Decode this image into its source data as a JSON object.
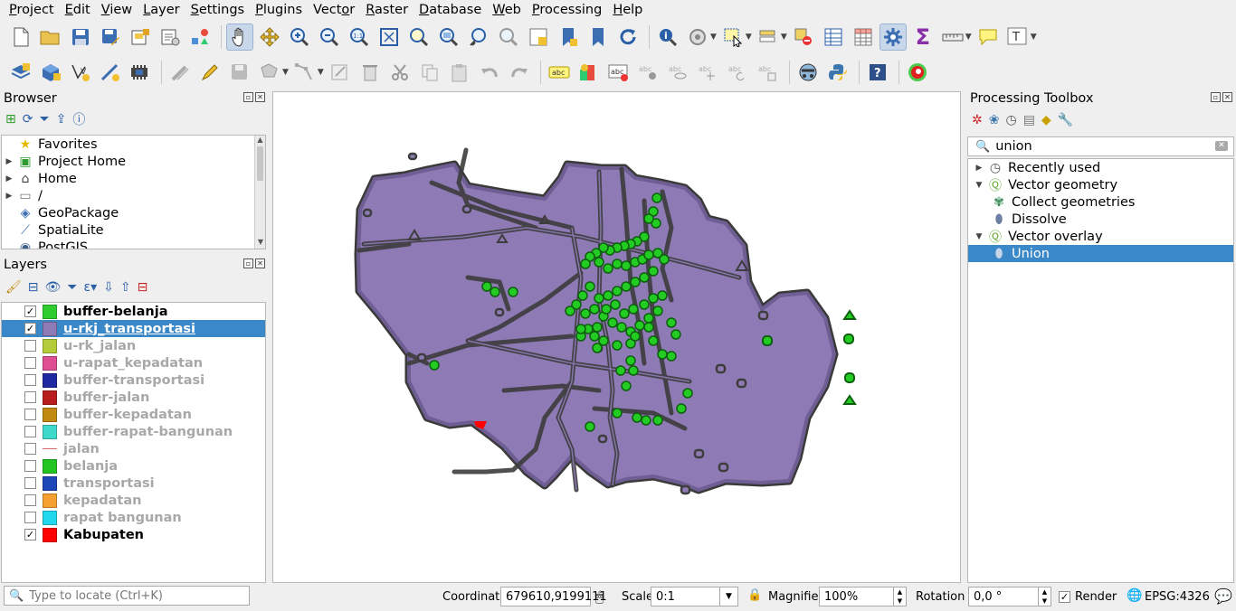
{
  "menu": [
    "Project",
    "Edit",
    "View",
    "Layer",
    "Settings",
    "Plugins",
    "Vector",
    "Raster",
    "Database",
    "Web",
    "Processing",
    "Help"
  ],
  "menu_underline": [
    "P",
    "E",
    "V",
    "L",
    "S",
    "P",
    "o",
    "R",
    "D",
    "W",
    "P",
    "H"
  ],
  "browser": {
    "title": "Browser",
    "items": [
      {
        "label": "Favorites",
        "icon": "star-icon",
        "expandable": false
      },
      {
        "label": "Project Home",
        "icon": "project-home-icon",
        "expandable": true
      },
      {
        "label": "Home",
        "icon": "home-icon",
        "expandable": true
      },
      {
        "label": "/",
        "icon": "folder-icon",
        "expandable": true
      },
      {
        "label": "GeoPackage",
        "icon": "geopackage-icon",
        "expandable": false
      },
      {
        "label": "SpatiaLite",
        "icon": "spatialite-icon",
        "expandable": false
      },
      {
        "label": "PostGIS",
        "icon": "postgis-icon",
        "expandable": false
      }
    ]
  },
  "layers": {
    "title": "Layers",
    "items": [
      {
        "label": "buffer-belanja",
        "checked": true,
        "color": "#2ecc2e",
        "selected": false,
        "style": "fill"
      },
      {
        "label": "u-rkj_transportasi",
        "checked": true,
        "color": "#8e7ab5",
        "selected": true,
        "style": "fill"
      },
      {
        "label": "u-rk_jalan",
        "checked": false,
        "color": "#b5cc3a",
        "selected": false,
        "style": "fill"
      },
      {
        "label": "u-rapat_kepadatan",
        "checked": false,
        "color": "#dd4f92",
        "selected": false,
        "style": "fill"
      },
      {
        "label": "buffer-transportasi",
        "checked": false,
        "color": "#1f2aa0",
        "selected": false,
        "style": "fill"
      },
      {
        "label": "buffer-jalan",
        "checked": false,
        "color": "#b81c1c",
        "selected": false,
        "style": "fill"
      },
      {
        "label": "buffer-kepadatan",
        "checked": false,
        "color": "#c08a10",
        "selected": false,
        "style": "fill"
      },
      {
        "label": "buffer-rapat-bangunan",
        "checked": false,
        "color": "#3fd9cc",
        "selected": false,
        "style": "fill"
      },
      {
        "label": "jalan",
        "checked": false,
        "color": "#d46a6a",
        "selected": false,
        "style": "line"
      },
      {
        "label": "belanja",
        "checked": false,
        "color": "#22c422",
        "selected": false,
        "style": "fill"
      },
      {
        "label": "transportasi",
        "checked": false,
        "color": "#1f46b8",
        "selected": false,
        "style": "fill"
      },
      {
        "label": "kepadatan",
        "checked": false,
        "color": "#f5a030",
        "selected": false,
        "style": "fill"
      },
      {
        "label": "rapat bangunan",
        "checked": false,
        "color": "#22d8ee",
        "selected": false,
        "style": "fill"
      },
      {
        "label": "Kabupaten",
        "checked": true,
        "color": "#ff0000",
        "selected": false,
        "style": "fill"
      }
    ]
  },
  "toolbox": {
    "title": "Processing Toolbox",
    "search_value": "union",
    "tree": [
      {
        "label": "Recently used",
        "level": 0,
        "expanded": false,
        "icon": "clock-icon",
        "selected": false
      },
      {
        "label": "Vector geometry",
        "level": 0,
        "expanded": true,
        "icon": "qgis-q-icon",
        "selected": false
      },
      {
        "label": "Collect geometries",
        "level": 1,
        "icon": "collect-geometries-icon",
        "selected": false
      },
      {
        "label": "Dissolve",
        "level": 1,
        "icon": "dissolve-icon",
        "selected": false
      },
      {
        "label": "Vector overlay",
        "level": 0,
        "expanded": true,
        "icon": "qgis-q-icon",
        "selected": false
      },
      {
        "label": "Union",
        "level": 1,
        "icon": "union-icon",
        "selected": true
      }
    ]
  },
  "status": {
    "locator_placeholder": "Type to locate (Ctrl+K)",
    "coordinate_label": "Coordinate",
    "coordinate_value": "679610,9199111",
    "scale_label": "Scale",
    "scale_value": "0:1",
    "magnifier_label": "Magnifier",
    "magnifier_value": "100%",
    "rotation_label": "Rotation",
    "rotation_value": "0,0 °",
    "render_label": "Render",
    "render_checked": true,
    "crs": "EPSG:4326"
  }
}
